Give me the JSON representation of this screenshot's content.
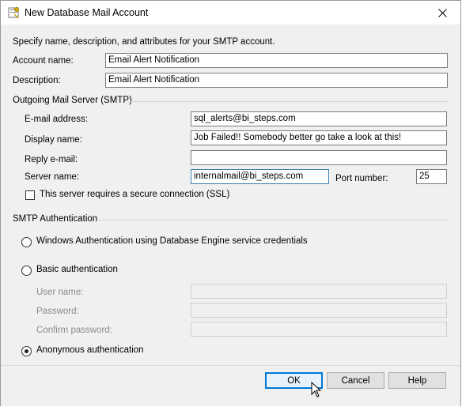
{
  "window": {
    "title": "New Database Mail Account"
  },
  "intro": "Specify name, description, and attributes for your SMTP account.",
  "account": {
    "name_label": "Account name:",
    "name_value": "Email Alert Notification",
    "description_label": "Description:",
    "description_value": "Email Alert Notification"
  },
  "smtp_server": {
    "group_label": "Outgoing Mail Server (SMTP)",
    "email_label": "E-mail address:",
    "email_value": "sql_alerts@bi_steps.com",
    "display_label": "Display name:",
    "display_value": "Job Failed!!  Somebody better go take a look at this!",
    "reply_label": "Reply e-mail:",
    "reply_value": "",
    "server_label": "Server name:",
    "server_value": "internalmail@bi_steps.com",
    "port_label": "Port number:",
    "port_value": "25",
    "ssl_label": "This server requires a secure connection (SSL)",
    "ssl_checked": false
  },
  "auth": {
    "group_label": "SMTP Authentication",
    "windows_label": "Windows Authentication using Database Engine service credentials",
    "basic_label": "Basic authentication",
    "user_label": "User name:",
    "password_label": "Password:",
    "confirm_label": "Confirm password:",
    "anonymous_label": "Anonymous authentication",
    "selected": "anonymous"
  },
  "buttons": {
    "ok": "OK",
    "cancel": "Cancel",
    "help": "Help"
  },
  "icons": [
    "app-icon",
    "close-icon",
    "mouse-cursor-icon"
  ]
}
